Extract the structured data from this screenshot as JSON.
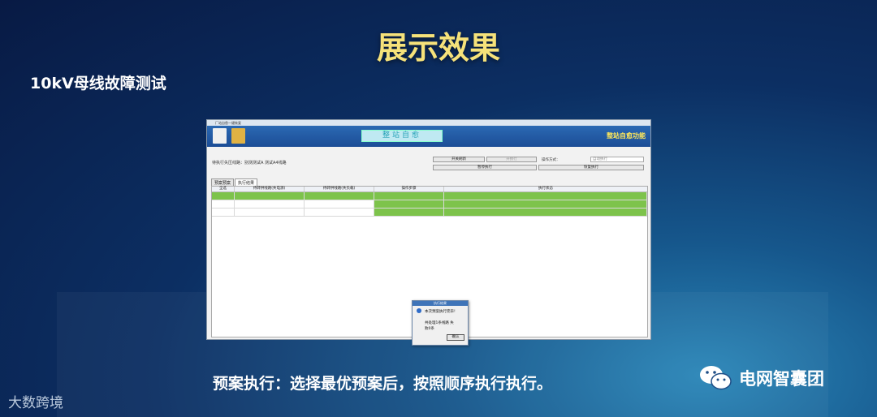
{
  "slide": {
    "title": "展示效果",
    "section_title": "10kV母线故障测试",
    "caption": "预案执行：选择最优预案后，按照顺序执行执行。",
    "brand_left": "大数跨境",
    "brand_right": "电网智囊团"
  },
  "app": {
    "window_title": "厂站自愈一键恢复",
    "icon_left_1": "document-icon",
    "icon_left_2": "user-icon",
    "header_center": "整站自愈",
    "header_right": "整站自愈功能",
    "route_label": "待执行失压线路：别测测试A 测试A4线路",
    "buttons": {
      "switch_refresh": "开关刷新",
      "execute": "开执行",
      "pause": "暂停执行",
      "restore": "恢复执行"
    },
    "mode_label": "操作方式：",
    "mode_value": "自动执行",
    "tabs": [
      "预案预案",
      "执行结果"
    ],
    "table_headers": [
      "全选",
      "待转供线路(失电源)",
      "待转供线路(失负载)",
      "操作步骤",
      "执行状态"
    ],
    "dialog": {
      "title": "执行结果",
      "message": "本次预案执行完毕!",
      "detail_1": "共处理1条线路 失",
      "detail_2": "败0条",
      "ok": "确认"
    }
  },
  "colors": {
    "title_gold": "#f6e27a",
    "row_green": "#7dc34b",
    "header_blue": "#1c4d96"
  }
}
